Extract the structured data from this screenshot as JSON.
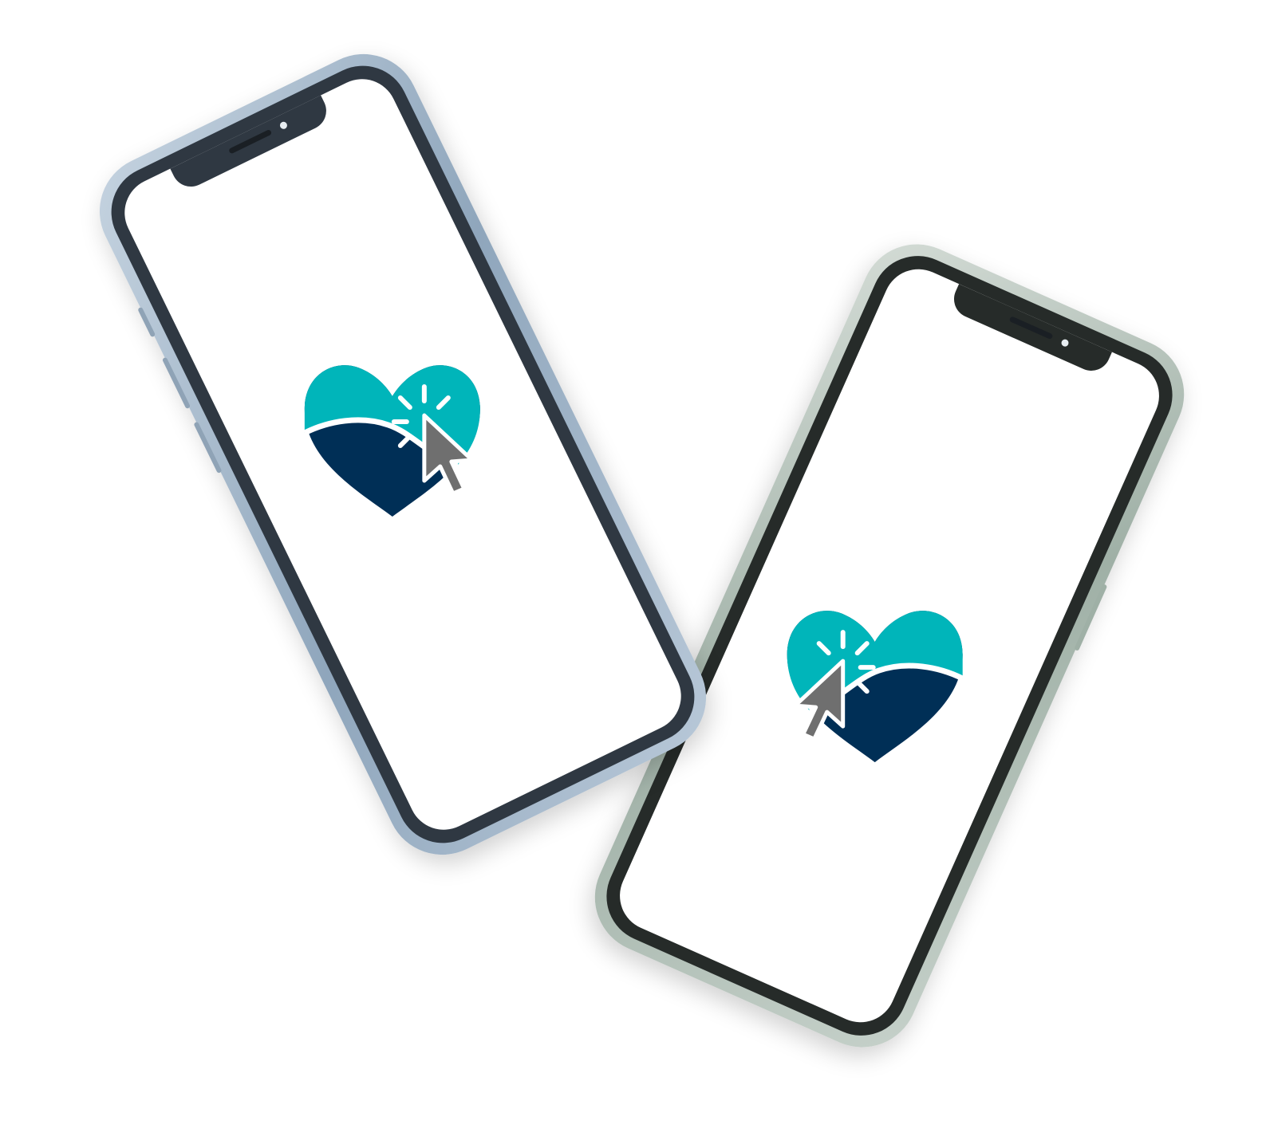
{
  "colors": {
    "heart_teal": "#00b5ba",
    "heart_navy": "#002f56",
    "cursor_gray": "#6f6f6f",
    "background": "#ffffff"
  },
  "phones": [
    {
      "id": "left",
      "frame_color": "silver-blue",
      "logo": "heart-cursor-logo"
    },
    {
      "id": "right",
      "frame_color": "silver-green",
      "logo": "heart-cursor-logo"
    }
  ]
}
